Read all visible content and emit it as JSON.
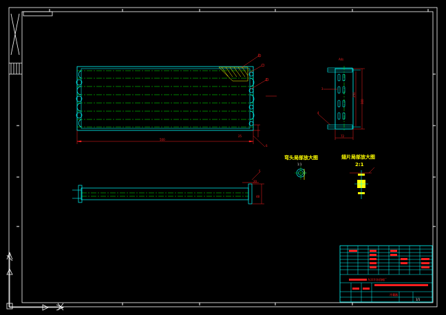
{
  "drawing": {
    "colors": {
      "background": "#000000",
      "frame": "#ffffff",
      "geometry": "#00ffff",
      "centerline": "#00ff00",
      "dimension": "#ff2020",
      "detail": "#ffff00"
    },
    "views": {
      "side_view_label": "A向",
      "detail_tube_title": "弯头局部放大图",
      "detail_tube_scale": "1:1",
      "detail_fin_title": "翅片局部放大图",
      "detail_fin_scale": "2:1"
    },
    "dimensions": {
      "front_length": "500",
      "front_small": "25",
      "side_height": "300",
      "side_height_inner": "250",
      "side_width": "72",
      "bottom_height": "48",
      "bottom_small": "20"
    },
    "balloons": [
      "1",
      "2",
      "3",
      "4",
      "5",
      "6"
    ],
    "title_block": {
      "company": "东洋冷冻机械厂",
      "part_name": "冷凝器",
      "sheet": "1/1"
    }
  }
}
